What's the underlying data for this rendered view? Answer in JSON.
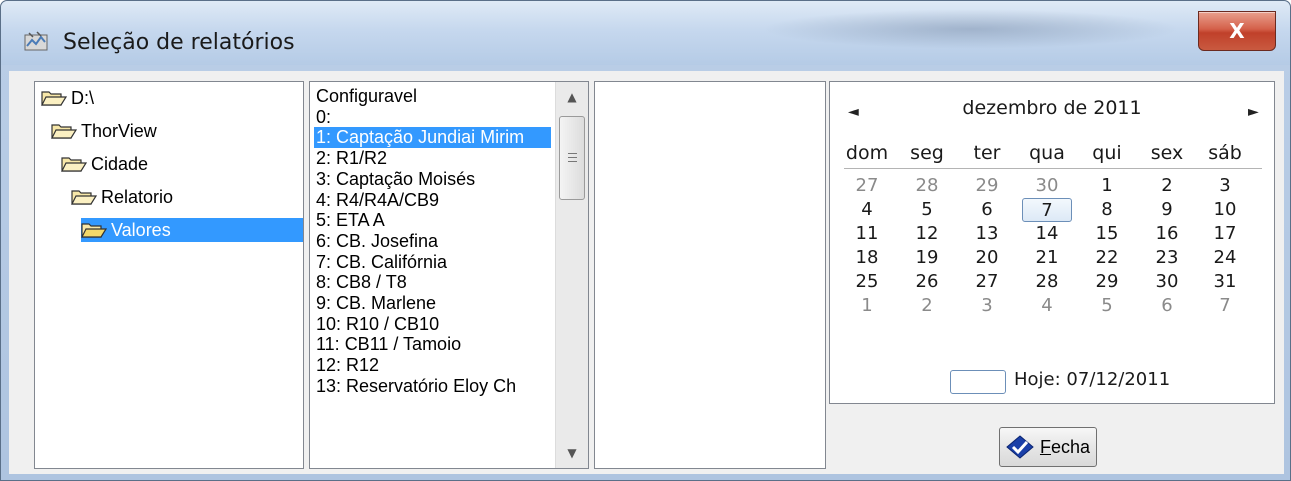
{
  "window": {
    "title": "Seleção de relatórios",
    "close_glyph": "X"
  },
  "folders": [
    {
      "label": "D:\\",
      "icon": "folder-open-icon",
      "indent": 0,
      "selected": false
    },
    {
      "label": "ThorView",
      "icon": "folder-open-icon",
      "indent": 1,
      "selected": false
    },
    {
      "label": "Cidade",
      "icon": "folder-open-icon",
      "indent": 2,
      "selected": false
    },
    {
      "label": "Relatorio",
      "icon": "folder-open-icon",
      "indent": 3,
      "selected": false
    },
    {
      "label": "Valores",
      "icon": "folder-open-icon",
      "indent": 4,
      "selected": true
    }
  ],
  "reports": {
    "items": [
      "Configuravel",
      "0:",
      "1: Captação Jundiai Mirim",
      "2: R1/R2",
      "3: Captação Moisés",
      "4: R4/R4A/CB9",
      "5: ETA A",
      "6: CB. Josefina",
      "7: CB. Califórnia",
      "8: CB8 / T8",
      "9: CB. Marlene",
      "10: R10 / CB10",
      "11: CB11 / Tamoio",
      "12: R12",
      "13: Reservatório Eloy Ch"
    ],
    "selected_index": 2
  },
  "calendar": {
    "month_title": "dezembro de 2011",
    "prev_glyph": "◄",
    "next_glyph": "►",
    "weekdays": [
      "dom",
      "seg",
      "ter",
      "qua",
      "qui",
      "sex",
      "sáb"
    ],
    "weeks": [
      [
        "27",
        "28",
        "29",
        "30",
        "1",
        "2",
        "3"
      ],
      [
        "4",
        "5",
        "6",
        "7",
        "8",
        "9",
        "10"
      ],
      [
        "11",
        "12",
        "13",
        "14",
        "15",
        "16",
        "17"
      ],
      [
        "18",
        "19",
        "20",
        "21",
        "22",
        "23",
        "24"
      ],
      [
        "25",
        "26",
        "27",
        "28",
        "29",
        "30",
        "31"
      ],
      [
        "1",
        "2",
        "3",
        "4",
        "5",
        "6",
        "7"
      ]
    ],
    "other_month": [
      [
        true,
        true,
        true,
        true,
        false,
        false,
        false
      ],
      [
        false,
        false,
        false,
        false,
        false,
        false,
        false
      ],
      [
        false,
        false,
        false,
        false,
        false,
        false,
        false
      ],
      [
        false,
        false,
        false,
        false,
        false,
        false,
        false
      ],
      [
        false,
        false,
        false,
        false,
        false,
        false,
        false
      ],
      [
        true,
        true,
        true,
        true,
        true,
        true,
        true
      ]
    ],
    "today_text": "Hoje: 07/12/2011",
    "today_day": "7"
  },
  "close_button": {
    "accel": "F",
    "rest": "echa",
    "icon": "checkmark-diamond-icon"
  }
}
